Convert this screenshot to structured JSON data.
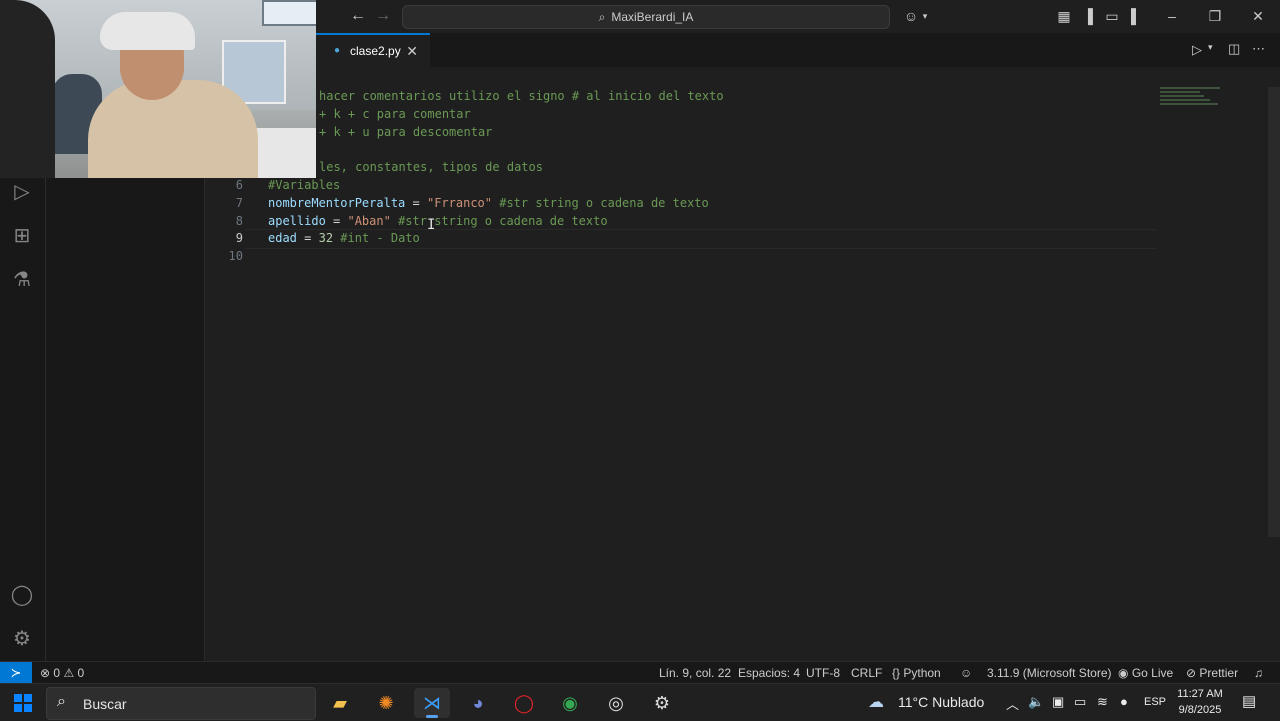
{
  "titlebar": {
    "search_text": "MaxiBerardi_IA"
  },
  "tabs": [
    {
      "label": "clase2.py"
    }
  ],
  "editor": {
    "lines": [
      {
        "num": "",
        "segments": [
          {
            "t": "hacer comentarios utilizo el signo # al inicio del texto",
            "c": "cmt"
          }
        ]
      },
      {
        "num": "",
        "segments": [
          {
            "t": "+ k + c para comentar",
            "c": "cmt"
          }
        ]
      },
      {
        "num": "",
        "segments": [
          {
            "t": "+ k + u para descomentar",
            "c": "cmt"
          }
        ]
      },
      {
        "num": "",
        "segments": []
      },
      {
        "num": "",
        "segments": [
          {
            "t": "les, constantes, tipos de datos",
            "c": "cmt"
          }
        ]
      },
      {
        "num": "6",
        "segments": [
          {
            "t": "#Variables",
            "c": "cmt"
          }
        ]
      },
      {
        "num": "7",
        "segments": [
          {
            "t": "nombreMentorPeralta",
            "c": "var"
          },
          {
            "t": " = ",
            "c": "op"
          },
          {
            "t": "\"Frranco\"",
            "c": "str"
          },
          {
            "t": " #str string o cadena de texto",
            "c": "cmt"
          }
        ]
      },
      {
        "num": "8",
        "segments": [
          {
            "t": "apellido",
            "c": "var"
          },
          {
            "t": " = ",
            "c": "op"
          },
          {
            "t": "\"Aban\"",
            "c": "str"
          },
          {
            "t": " #str string o cadena de texto",
            "c": "cmt"
          }
        ]
      },
      {
        "num": "9",
        "segments": [
          {
            "t": "edad",
            "c": "var"
          },
          {
            "t": " = ",
            "c": "op"
          },
          {
            "t": "32",
            "c": "num"
          },
          {
            "t": " #int - Dato",
            "c": "cmt"
          }
        ]
      },
      {
        "num": "10",
        "segments": []
      }
    ],
    "active_line": "9"
  },
  "statusbar": {
    "problems": "0",
    "warnings": "0",
    "cursor": "Lín. 9, col. 22",
    "spaces": "Espacios: 4",
    "encoding": "UTF-8",
    "eol": "CRLF",
    "language": "Python",
    "interpreter": "3.11.9 (Microsoft Store)",
    "golive": "Go Live",
    "prettier": "Prettier"
  },
  "taskbar": {
    "search_label": "Buscar",
    "weather": "11°C  Nublado",
    "lang": "ESP",
    "time": "11:27 AM",
    "date": "9/8/2025"
  }
}
